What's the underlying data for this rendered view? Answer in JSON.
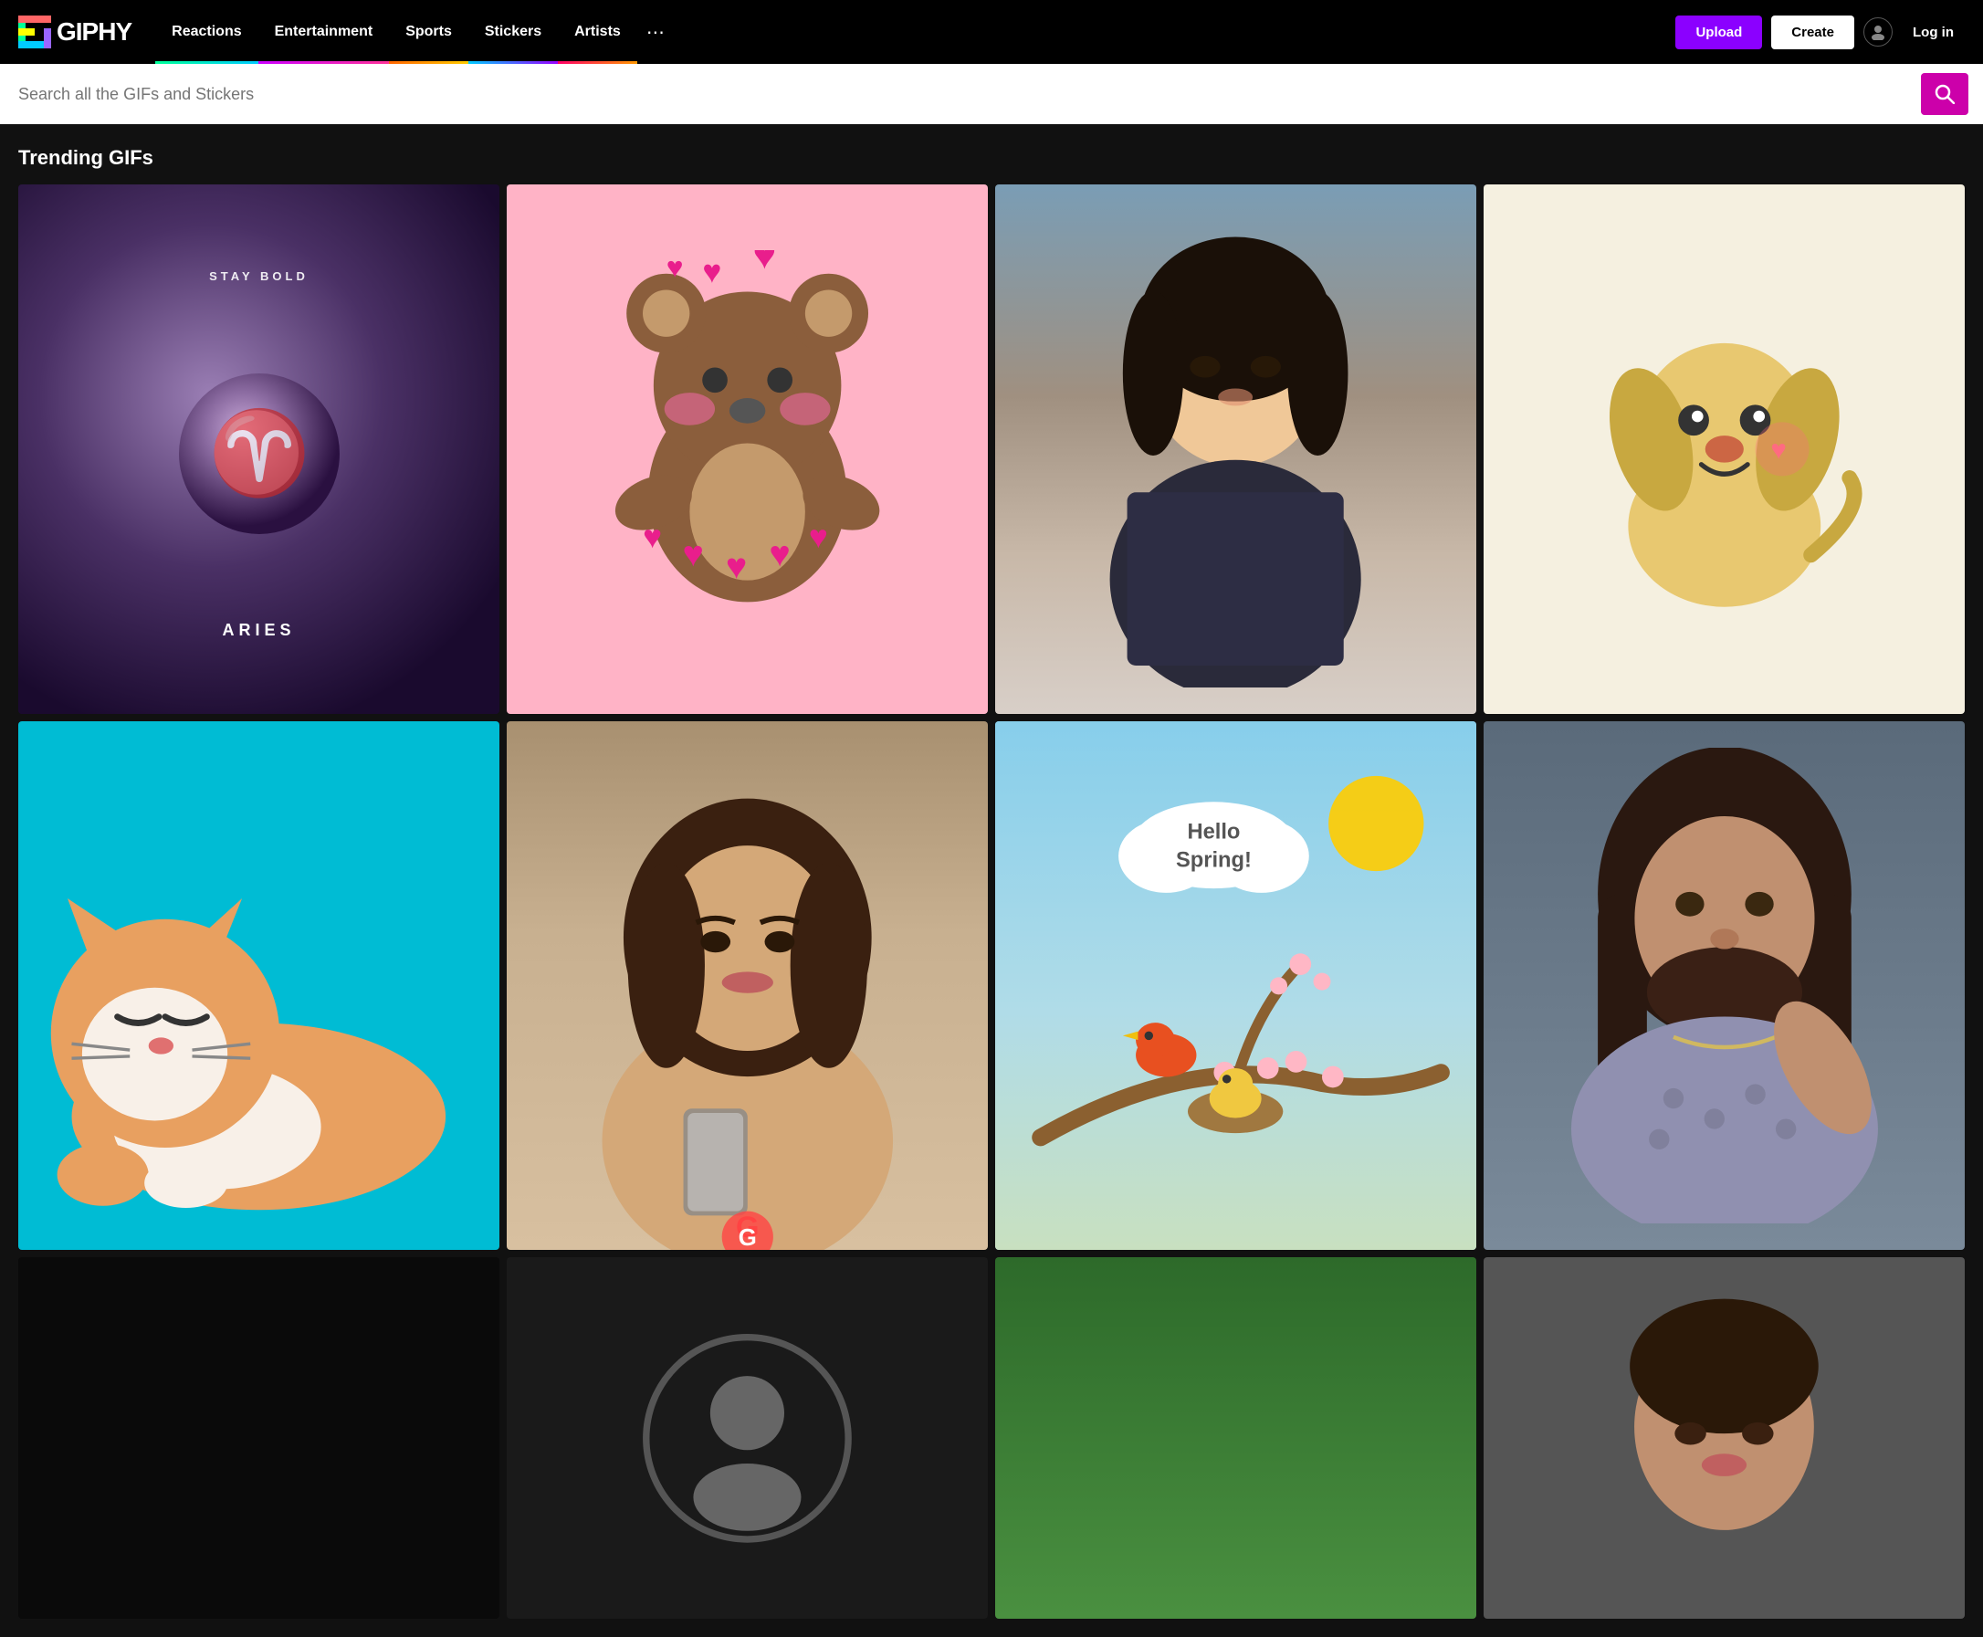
{
  "logo": {
    "text": "GIPHY"
  },
  "nav": {
    "items": [
      {
        "id": "reactions",
        "label": "Reactions",
        "class": "reactions"
      },
      {
        "id": "entertainment",
        "label": "Entertainment",
        "class": "entertainment"
      },
      {
        "id": "sports",
        "label": "Sports",
        "class": "sports"
      },
      {
        "id": "stickers",
        "label": "Stickers",
        "class": "stickers"
      },
      {
        "id": "artists",
        "label": "Artists",
        "class": "artists"
      }
    ],
    "upload_label": "Upload",
    "create_label": "Create",
    "login_label": "Log in"
  },
  "search": {
    "placeholder": "Search all the GIFs and Stickers"
  },
  "trending": {
    "title": "Trending GIFs"
  },
  "gifs": {
    "row1": [
      {
        "id": "gif-aries",
        "type": "moon",
        "alt": "Aries Moon Stay Bold"
      },
      {
        "id": "gif-bear",
        "type": "bear",
        "alt": "Cute Bear with Hearts"
      },
      {
        "id": "gif-person",
        "type": "person",
        "alt": "Asian woman portrait"
      },
      {
        "id": "gif-dog",
        "type": "dog",
        "alt": "Cute cartoon dog"
      }
    ],
    "row2": [
      {
        "id": "gif-cat",
        "type": "cat",
        "alt": "Sleeping cat on blue background"
      },
      {
        "id": "gif-kim",
        "type": "kim",
        "alt": "Woman holding phone"
      },
      {
        "id": "gif-spring",
        "type": "spring",
        "alt": "Hello Spring bird in nest"
      },
      {
        "id": "gif-jason",
        "type": "jason",
        "alt": "Man with long hair in patterned shirt"
      }
    ],
    "row3": [
      {
        "id": "gif-dark1",
        "type": "dark",
        "alt": "Dark GIF 1"
      },
      {
        "id": "gif-dark2",
        "type": "dark2",
        "alt": "Dark GIF 2"
      },
      {
        "id": "gif-green",
        "type": "green",
        "alt": "Green bottom GIF"
      },
      {
        "id": "gif-face",
        "type": "face",
        "alt": "Person face GIF"
      }
    ]
  },
  "spring_text": "Hello Spring!",
  "moon_top": "Stay Bold",
  "moon_bottom": "Aries"
}
